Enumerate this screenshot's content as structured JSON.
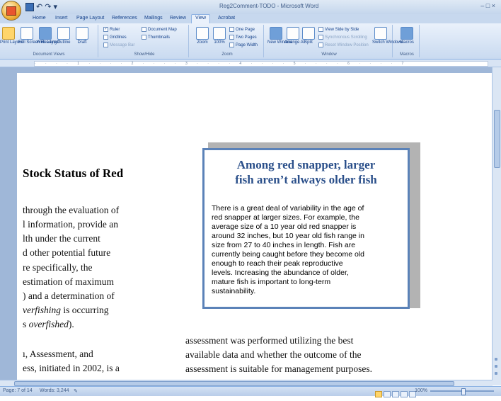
{
  "window": {
    "title": "Reg2Comment-TODO - Microsoft Word",
    "controls": "–  □  ×"
  },
  "tabs": [
    {
      "label": "Home"
    },
    {
      "label": "Insert"
    },
    {
      "label": "Page Layout"
    },
    {
      "label": "References"
    },
    {
      "label": "Mailings"
    },
    {
      "label": "Review"
    },
    {
      "label": "View",
      "active": true
    },
    {
      "label": "Acrobat"
    }
  ],
  "ribbon": {
    "document_views": {
      "label": "Document Views",
      "buttons": [
        "Print Layout",
        "Full Screen Reading",
        "Web Layout",
        "Outline",
        "Draft"
      ]
    },
    "show_hide": {
      "label": "Show/Hide",
      "items": [
        {
          "label": "Ruler",
          "checked": true
        },
        {
          "label": "Gridlines",
          "checked": false
        },
        {
          "label": "Message Bar",
          "checked": false
        },
        {
          "label": "Document Map",
          "checked": false
        },
        {
          "label": "Thumbnails",
          "checked": false
        }
      ]
    },
    "zoom": {
      "label": "Zoom",
      "buttons": [
        "Zoom",
        "100%"
      ],
      "options": [
        "One Page",
        "Two Pages",
        "Page Width"
      ]
    },
    "window": {
      "label": "Window",
      "buttons": [
        "New Window",
        "Arrange All",
        "Split"
      ],
      "options": [
        "View Side by Side",
        "Synchronous Scrolling",
        "Reset Window Position"
      ],
      "switch": "Switch Windows"
    },
    "macros": {
      "label": "Macros",
      "button": "Macros"
    }
  },
  "document": {
    "heading": "Stock Status of Red",
    "left_lines": [
      {
        "text": "through the evaluation of"
      },
      {
        "text": "l information, provide an"
      },
      {
        "text": "lth under the current"
      },
      {
        "text": "d other potential future"
      },
      {
        "text": "re specifically, the"
      },
      {
        "text": " estimation of maximum"
      },
      {
        "text": ") and a determination of"
      },
      {
        "pre": "",
        "em": "verfishing",
        "post": " is occurring"
      },
      {
        "pre": "s ",
        "em": "overfished",
        "post": ")."
      },
      {
        "text": "ı, Assessment, and"
      },
      {
        "text": "ess, initiated in 2002, is a"
      }
    ],
    "right_lines": [
      "assessment was performed utilizing the best",
      "available data and whether the outcome of the",
      "assessment is suitable for management purposes."
    ],
    "sidebox": {
      "title_lines": [
        "Among red snapper, larger",
        "fish aren’t always older fish"
      ],
      "lines": [
        "There is a great deal of variability in the age of",
        "red snapper at larger sizes.  For example, the",
        "average size of a 10 year old red snapper is",
        "around 32 inches, but 10 year old fish range in",
        "size from 27 to 40 inches in length.  Fish are",
        "currently being caught before they become old",
        "enough to reach their peak reproductive",
        "levels.  Increasing the abundance of older,",
        "mature fish is important to long-term",
        "sustainability."
      ]
    }
  },
  "status": {
    "page": "Page: 7 of 14",
    "words": "Words: 3,244",
    "zoom": "100%"
  },
  "colors": {
    "sidebox_border": "#5b82b8",
    "sidebox_title": "#2a4f8a",
    "ribbon_text": "#15428b"
  }
}
